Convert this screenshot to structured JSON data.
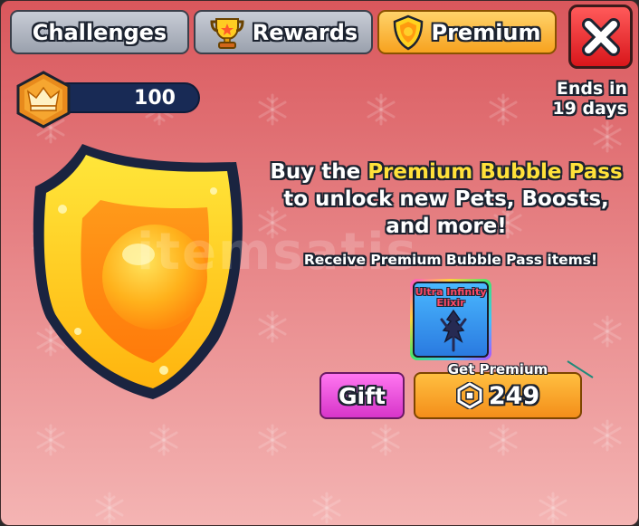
{
  "tabs": [
    {
      "label": "Challenges",
      "icon": "none",
      "active": false
    },
    {
      "label": "Rewards",
      "icon": "trophy-icon",
      "active": false
    },
    {
      "label": "Premium",
      "icon": "shield-icon",
      "active": true
    }
  ],
  "close_icon": "close-icon",
  "currency": {
    "icon": "crown-badge-icon",
    "value": "100"
  },
  "ends": {
    "line1": "Ends in",
    "line2": "19 days"
  },
  "headline": {
    "part1": "Buy the ",
    "highlight": "Premium Bubble Pass",
    "part2": " to unlock new Pets, Boosts, and more!"
  },
  "subline": "Receive Premium Bubble Pass items!",
  "item": {
    "label": "Ultra Infinity Elixir"
  },
  "watermark": "itemsatis",
  "actions": {
    "gift_label": "Gift",
    "get_premium_label": "Get Premium",
    "price": "249",
    "currency_icon": "robux-icon"
  },
  "colors": {
    "highlight": "#ffe13a",
    "active_tab": "#f7a21f",
    "gift": "#d735c9",
    "close": "#d8161b"
  }
}
